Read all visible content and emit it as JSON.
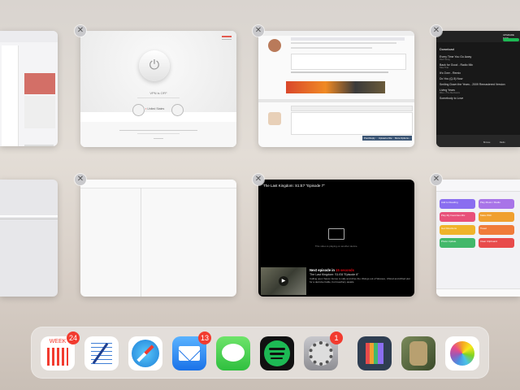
{
  "cards": {
    "vpn": {
      "brand": "",
      "status": "VPN is OFF",
      "location": "United States",
      "footer": ""
    },
    "forum": {
      "toolbar_title": "",
      "post_reply": "Post Reply",
      "upload_file": "Upload a File",
      "more_options": "More Options..."
    },
    "spotify": {
      "top_right": "UPGRADE NOW",
      "header": "Download",
      "songs": [
        {
          "title": "Every Time You Go Away",
          "artist": "Paul Young"
        },
        {
          "title": "Back for Good - Radio Mix",
          "artist": "Take That"
        },
        {
          "title": "It's Over - Remix",
          "artist": ""
        },
        {
          "title": "Do You (Q-5) Now",
          "artist": ""
        },
        {
          "title": "Smiling Down the Years - 2009 Remastered Version",
          "artist": ""
        },
        {
          "title": "Living Years",
          "artist": "Mike + The Mechanics"
        },
        {
          "title": "Somebody to Love",
          "artist": ""
        }
      ],
      "tabs": [
        "Browse",
        "Radio"
      ]
    },
    "video": {
      "title": "The Last Kingdom: S1:E7 \"Episode 7\"",
      "airplay_msg": "This video is playing on another device.",
      "next_label": "Next episode in",
      "next_countdown": "15 seconds",
      "next_title": "The Last Kingdom: S1:E8 \"Episode 8\"",
      "next_desc": "Calling upon Saxon forces to rally and drive the Vikings out of Wessex, Uhtred and Alfred plot for a decisive battle, but treachery awaits."
    },
    "shortcuts": {
      "tiles": [
        "Add to Reading",
        "Play Music / Radio",
        "Play My Favorites Mix",
        "Make PDF",
        "Get Directions",
        "Tweet",
        "Photo Update",
        "Clear Clipboard"
      ]
    }
  },
  "dock": {
    "calendar_day": "WEEK",
    "apps": [
      {
        "name": "Calendar",
        "badge": "24"
      },
      {
        "name": "Notes",
        "badge": ""
      },
      {
        "name": "Safari",
        "badge": ""
      },
      {
        "name": "Mail",
        "badge": "13"
      },
      {
        "name": "Messages",
        "badge": ""
      },
      {
        "name": "Spotify",
        "badge": ""
      },
      {
        "name": "Settings",
        "badge": "1"
      },
      {
        "name": "OmniFocus",
        "badge": ""
      },
      {
        "name": "Game",
        "badge": ""
      },
      {
        "name": "Photos",
        "badge": ""
      }
    ]
  },
  "colors": {
    "badge": "#f23b2f",
    "spotify_green": "#1db954",
    "mail_blue": "#2f8ff3",
    "messages_green": "#35c759"
  }
}
